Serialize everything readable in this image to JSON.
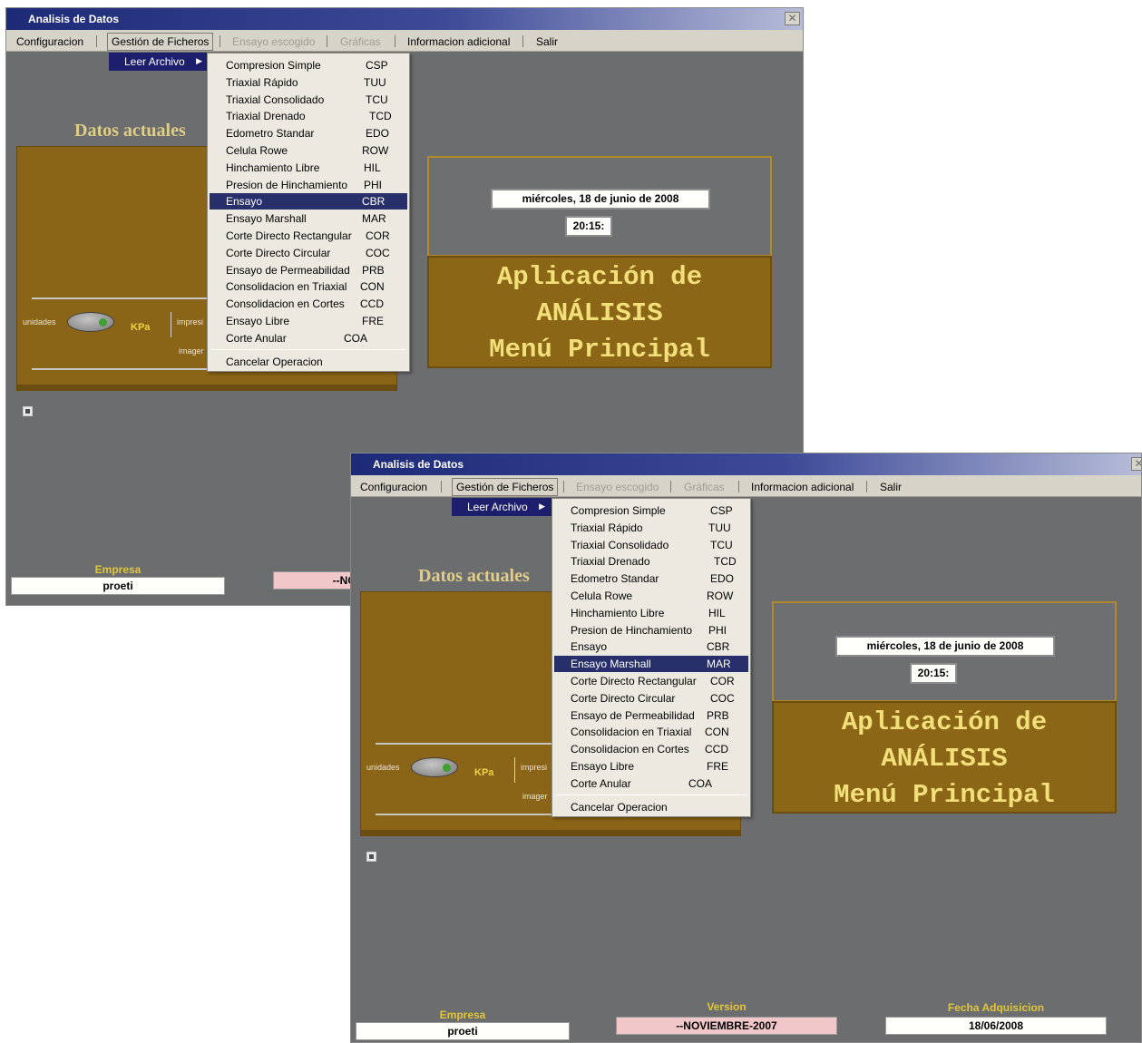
{
  "window": {
    "title": "Analisis de Datos",
    "close_glyph": "✕"
  },
  "menubar": {
    "items": [
      "Configuracion",
      "Gestión de Ficheros",
      "Ensayo escogido",
      "Gráficas",
      "Informacion adicional",
      "Salir"
    ]
  },
  "submenu": {
    "label": "Leer Archivo",
    "arrow": "▶"
  },
  "dropdown": {
    "items": [
      {
        "label": "Compresion Simple",
        "code": "CSP"
      },
      {
        "label": "Triaxial Rápido",
        "code": "TUU"
      },
      {
        "label": "Triaxial Consolidado",
        "code": "TCU"
      },
      {
        "label": "Triaxial Drenado",
        "code": "TCD"
      },
      {
        "label": "Edometro Standar",
        "code": "EDO"
      },
      {
        "label": "Celula Rowe",
        "code": "ROW"
      },
      {
        "label": "Hinchamiento Libre",
        "code": "HIL"
      },
      {
        "label": "Presion de Hinchamiento",
        "code": "PHI"
      },
      {
        "label": "Ensayo",
        "code": "CBR"
      },
      {
        "label": "Ensayo Marshall",
        "code": "MAR"
      },
      {
        "label": "Corte Directo Rectangular",
        "code": "COR"
      },
      {
        "label": "Corte Directo Circular",
        "code": "COC"
      },
      {
        "label": "Ensayo de Permeabilidad",
        "code": "PRB"
      },
      {
        "label": "Consolidacion en Triaxial",
        "code": "CON"
      },
      {
        "label": "Consolidacion en Cortes",
        "code": "CCD"
      },
      {
        "label": "Ensayo Libre",
        "code": "FRE"
      },
      {
        "label": "Corte Anular",
        "code": "COA"
      }
    ],
    "cancel": "Cancelar Operacion"
  },
  "screen1": {
    "highlighted": "Ensayo"
  },
  "screen2": {
    "highlighted": "Ensayo Marshall"
  },
  "main": {
    "datos_title": "Datos actuales",
    "units_label": "unidades",
    "units_value": "KPa",
    "impresion_label": "impresi",
    "imagen_label": "imager",
    "date": "miércoles, 18 de junio de 2008",
    "time": "20:15:",
    "app_line1": "Aplicación de",
    "app_line2": "ANÁLISIS",
    "app_line3": "Menú Principal"
  },
  "footer": {
    "empresa_label": "Empresa",
    "empresa_value": "proeti",
    "version_label": "Version",
    "version_value": "--NOVIEMBRE-2007",
    "version_value_partial": "--NC",
    "fecha_label": "Fecha Adquisicion",
    "fecha_value": "18/06/2008"
  },
  "colors": {
    "menu_highlight": "#27306b",
    "gold_panel": "#8a6616",
    "app_text": "#f2df7a",
    "footer_label": "#e1c63a",
    "version_box": "#f2c7c9"
  }
}
